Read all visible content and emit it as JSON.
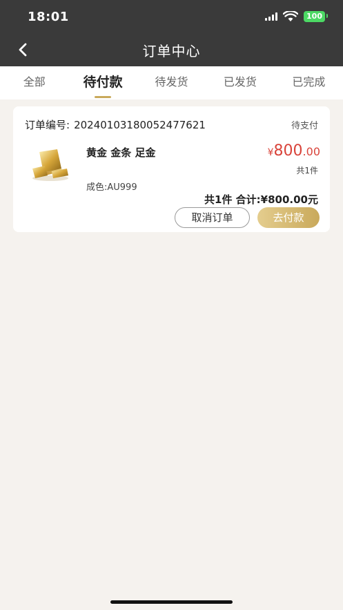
{
  "status_bar": {
    "time": "18:01",
    "battery": "100"
  },
  "header": {
    "title": "订单中心"
  },
  "tabs": [
    {
      "label": "全部",
      "active": false
    },
    {
      "label": "待付款",
      "active": true
    },
    {
      "label": "待发货",
      "active": false
    },
    {
      "label": "已发货",
      "active": false
    },
    {
      "label": "已完成",
      "active": false
    }
  ],
  "order": {
    "number_label": "订单编号:",
    "number": "20240103180052477621",
    "status": "待支付",
    "product": {
      "name": "黄金 金条 足金",
      "spec": "成色:AU999",
      "price_symbol": "¥",
      "price_int": "800",
      "price_dec": ".00",
      "qty": "共1件"
    },
    "total": "共1件 合计:¥800.00元",
    "cancel_label": "取消订单",
    "pay_label": "去付款"
  },
  "colors": {
    "accent": "#c9a95b",
    "price": "#d9433a",
    "header_bg": "#3a3a3a"
  }
}
